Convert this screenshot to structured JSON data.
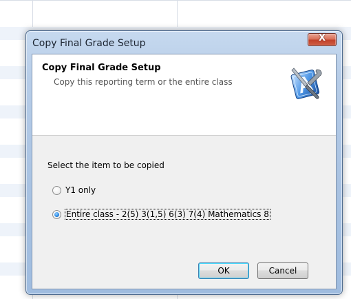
{
  "window": {
    "title": "Copy Final Grade Setup",
    "close_glyph": "X"
  },
  "header": {
    "title": "Copy Final Grade Setup",
    "subtitle": "Copy this reporting term or the entire class",
    "icon": "app-tools-icon"
  },
  "body": {
    "prompt": "Select the item to be copied",
    "options": [
      {
        "label": "Y1 only",
        "checked": false
      },
      {
        "label": "Entire class - 2(5) 3(1,5) 6(3) 7(4) Mathematics 8",
        "checked": true
      }
    ]
  },
  "buttons": {
    "ok": "OK",
    "cancel": "Cancel"
  },
  "colors": {
    "frame": "#a8c2e2",
    "close_button": "#c2412a",
    "radio_selected": "#2a8ce8",
    "default_button_glow": "#48d8fb"
  }
}
